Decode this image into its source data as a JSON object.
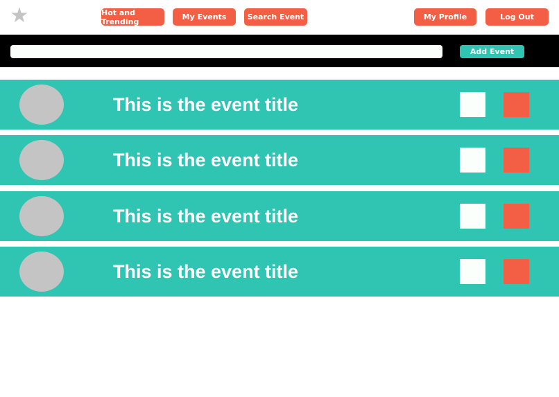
{
  "nav": {
    "logo_icon": "star-icon",
    "hot_label": "Hot and Trending",
    "my_events_label": "My Events",
    "search_label": "Search Event",
    "profile_label": "My Profile",
    "logout_label": "Log Out"
  },
  "toolbar": {
    "search_value": "",
    "search_placeholder": "",
    "add_label": "Add Event"
  },
  "events": [
    {
      "title": "This is the event title"
    },
    {
      "title": "This is the event title"
    },
    {
      "title": "This is the event title"
    },
    {
      "title": "This is the event title"
    }
  ],
  "colors": {
    "accent_red": "#f35f44",
    "accent_teal": "#30c4b3",
    "toolbar_bg": "#000000",
    "avatar_gray": "#c4c4c4",
    "off_white": "#fafffb"
  }
}
